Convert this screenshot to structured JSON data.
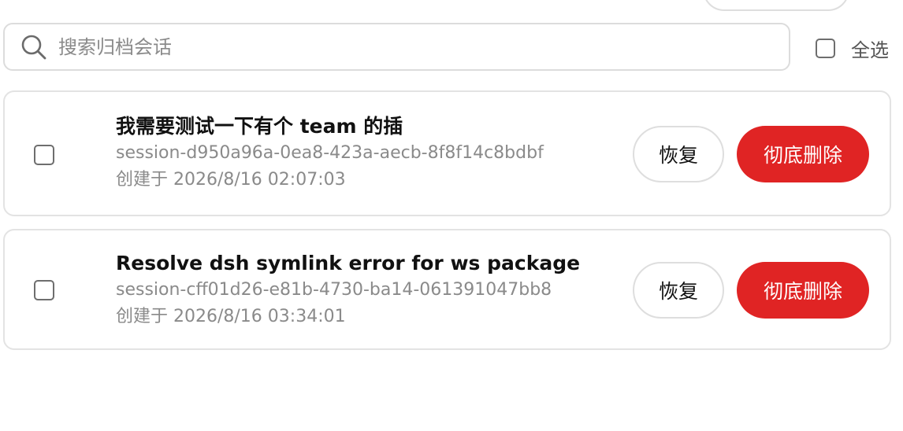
{
  "search": {
    "placeholder": "搜索归档会话"
  },
  "select_all": {
    "label": "全选",
    "checked": false
  },
  "actions": {
    "restore_label": "恢复",
    "delete_label": "彻底删除"
  },
  "sessions": [
    {
      "title": "我需要测试一下有个 team 的插",
      "id": "session-d950a96a-0ea8-423a-aecb-8f8f14c8bdbf",
      "created": "创建于 2026/8/16 02:07:03",
      "checked": false
    },
    {
      "title": "Resolve dsh symlink error for ws package",
      "id": "session-cff01d26-e81b-4730-ba14-061391047bb8",
      "created": "创建于 2026/8/16 03:34:01",
      "checked": false
    }
  ],
  "colors": {
    "delete": "#e02424",
    "border": "#e3e3e3",
    "muted_text": "#8a8a8a"
  },
  "icons": {
    "search": "search-icon"
  }
}
